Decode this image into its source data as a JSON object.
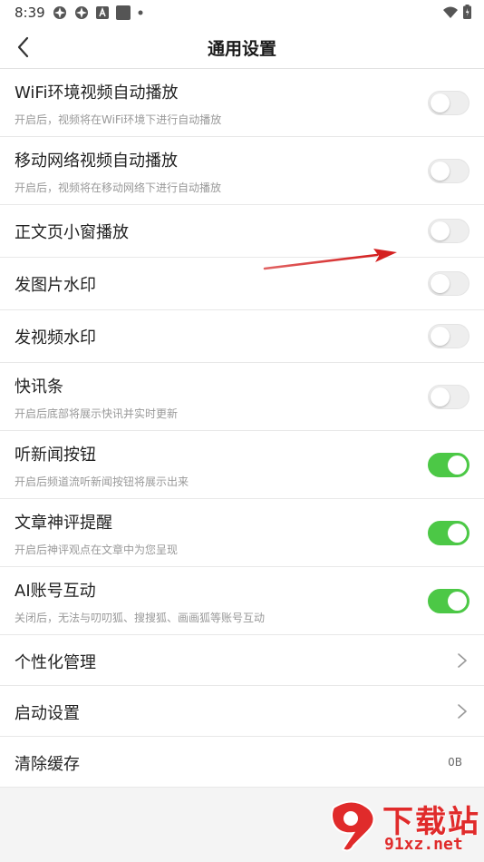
{
  "status_bar": {
    "time": "8:39"
  },
  "header": {
    "title": "通用设置"
  },
  "settings": [
    {
      "title": "WiFi环境视频自动播放",
      "desc": "开启后，视频将在WiFi环境下进行自动播放",
      "toggle": false
    },
    {
      "title": "移动网络视频自动播放",
      "desc": "开启后，视频将在移动网络下进行自动播放",
      "toggle": false
    },
    {
      "title": "正文页小窗播放",
      "toggle": false
    },
    {
      "title": "发图片水印",
      "toggle": false
    },
    {
      "title": "发视频水印",
      "toggle": false
    },
    {
      "title": "快讯条",
      "desc": "开启后底部将展示快讯并实时更新",
      "toggle": false
    },
    {
      "title": "听新闻按钮",
      "desc": "开启后频道流听新闻按钮将展示出来",
      "toggle": true
    },
    {
      "title": "文章神评提醒",
      "desc": "开启后神评观点在文章中为您呈现",
      "toggle": true
    },
    {
      "title": "AI账号互动",
      "desc": "关闭后，无法与叨叨狐、搜搜狐、画画狐等账号互动",
      "toggle": true
    }
  ],
  "nav_items": [
    {
      "title": "个性化管理"
    },
    {
      "title": "启动设置"
    },
    {
      "title": "清除缓存",
      "value": "0B"
    }
  ],
  "colors": {
    "toggle_on": "#4cc846",
    "toggle_off": "#eeeeee",
    "annotation_arrow": "#d42020",
    "watermark": "#e02b2b"
  },
  "watermark": {
    "main": "下载站",
    "sub": "91xz.net"
  }
}
